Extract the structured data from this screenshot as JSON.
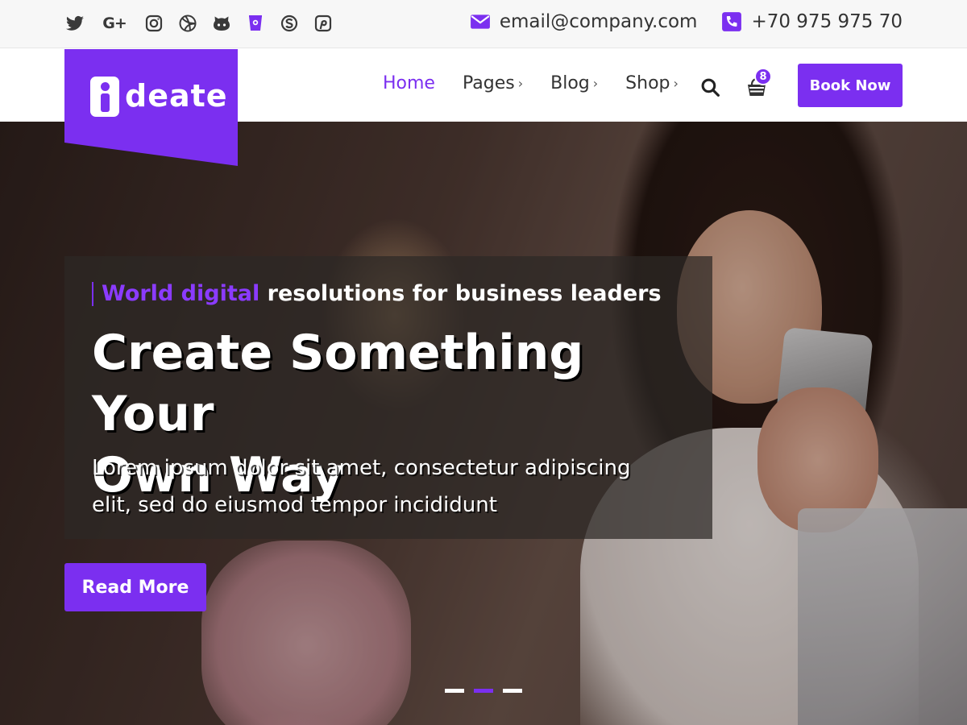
{
  "topbar": {
    "social": [
      {
        "name": "twitter-icon"
      },
      {
        "name": "google-plus-icon",
        "label": "G+"
      },
      {
        "name": "instagram-icon"
      },
      {
        "name": "dribbble-icon"
      },
      {
        "name": "github-icon"
      },
      {
        "name": "bucket-icon"
      },
      {
        "name": "skype-icon"
      },
      {
        "name": "pinterest-icon"
      }
    ],
    "email": "email@company.com",
    "phone": "+70 975 975 70"
  },
  "header": {
    "logo_text": "deate",
    "nav": [
      {
        "label": "Home",
        "active": true,
        "has_submenu": false
      },
      {
        "label": "Pages",
        "active": false,
        "has_submenu": true
      },
      {
        "label": "Blog",
        "active": false,
        "has_submenu": true
      },
      {
        "label": "Shop",
        "active": false,
        "has_submenu": true
      }
    ],
    "submenu_indicator": "›",
    "cart_count": "8",
    "book_button": "Book Now"
  },
  "hero": {
    "tagline_accent": "World digital",
    "tagline_rest": "resolutions for business leaders",
    "headline_line1": "Create Something Your",
    "headline_line2": "Own Way",
    "description_line1": "Lorem ipsum dolor sit amet, consectetur adipiscing",
    "description_line2": "elit, sed do eiusmod tempor incididunt",
    "read_more": "Read More",
    "slides": 3,
    "active_slide": 2
  },
  "colors": {
    "accent": "#7b2ff0",
    "topbar_bg": "#f7f7f7",
    "text_dark": "#333333"
  }
}
